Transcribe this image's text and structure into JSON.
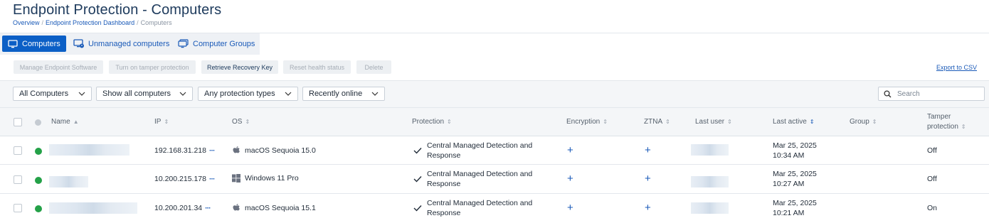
{
  "header": {
    "title": "Endpoint Protection - Computers",
    "breadcrumb": [
      "Overview",
      "Endpoint Protection Dashboard",
      "Computers"
    ]
  },
  "tabs": [
    {
      "label": "Computers",
      "icon": "monitor-icon",
      "active": true
    },
    {
      "label": "Unmanaged computers",
      "icon": "unmanaged-computer-icon",
      "active": false
    },
    {
      "label": "Computer Groups",
      "icon": "computer-groups-icon",
      "active": false
    }
  ],
  "toolbar": {
    "buttons": [
      {
        "label": "Manage Endpoint Software",
        "enabled": false
      },
      {
        "label": "Turn on tamper protection",
        "enabled": false
      },
      {
        "label": "Retrieve Recovery Key",
        "enabled": true
      },
      {
        "label": "Reset health status",
        "enabled": false
      },
      {
        "label": "Delete",
        "enabled": false
      }
    ],
    "export_label": "Export to CSV"
  },
  "filters": {
    "selects": [
      "All Computers",
      "Show all computers",
      "Any protection types",
      "Recently online"
    ],
    "search_placeholder": "Search"
  },
  "table": {
    "columns": [
      "Name",
      "IP",
      "OS",
      "Protection",
      "Encryption",
      "ZTNA",
      "Last user",
      "Last active",
      "Group",
      "Tamper protection"
    ],
    "sorted_column": "Last active",
    "rows": [
      {
        "status": "healthy",
        "ip": "192.168.31.218",
        "os": "macOS Sequoia 15.0",
        "os_icon": "apple-icon",
        "protection": "Central Managed Detection and Response",
        "encryption": "+",
        "ztna": "+",
        "last_active_date": "Mar 25, 2025",
        "last_active_time": "10:34 AM",
        "group": "",
        "tamper": "Off"
      },
      {
        "status": "healthy",
        "ip": "10.200.215.178",
        "os": "Windows 11 Pro",
        "os_icon": "windows-icon",
        "protection": "Central Managed Detection and Response",
        "encryption": "+",
        "ztna": "+",
        "last_active_date": "Mar 25, 2025",
        "last_active_time": "10:27 AM",
        "group": "",
        "tamper": "Off"
      },
      {
        "status": "healthy",
        "ip": "10.200.201.34",
        "os": "macOS Sequoia 15.1",
        "os_icon": "apple-icon",
        "protection": "Central Managed Detection and Response",
        "encryption": "+",
        "ztna": "+",
        "last_active_date": "Mar 25, 2025",
        "last_active_time": "10:21 AM",
        "group": "",
        "tamper": "On"
      }
    ]
  },
  "colors": {
    "accent": "#0b5fc6",
    "link": "#1a5ab8",
    "healthy": "#24a148",
    "title": "#1d3a5c"
  }
}
